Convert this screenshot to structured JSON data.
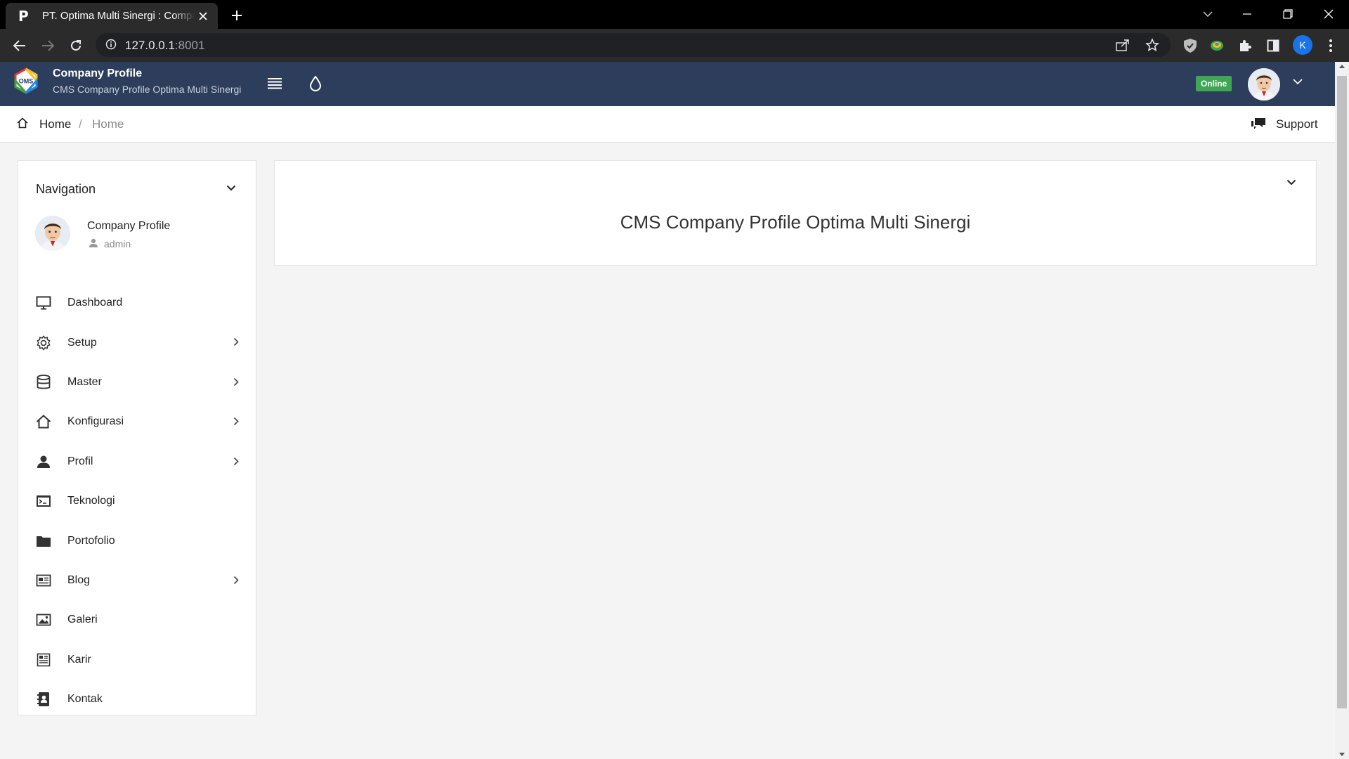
{
  "browser": {
    "tab_title": "PT. Optima Multi Sinergi : Company Profile",
    "favicon_letter": "P",
    "url_host": "127.0.0.1",
    "url_port": ":8001",
    "profile_initial": "K"
  },
  "header": {
    "logo_text": "OMS",
    "brand_title": "Company Profile",
    "brand_subtitle": "CMS Company Profile Optima Multi Sinergi",
    "status_badge": "Online"
  },
  "breadcrumb": {
    "home": "Home",
    "separator": "/",
    "current": "Home",
    "support": "Support"
  },
  "sidebar": {
    "title": "Navigation",
    "user_name": "Company Profile",
    "user_role": "admin",
    "items": [
      {
        "label": "Dashboard",
        "icon": "monitor-icon",
        "has_children": false
      },
      {
        "label": "Setup",
        "icon": "gear-icon",
        "has_children": true
      },
      {
        "label": "Master",
        "icon": "database-icon",
        "has_children": true
      },
      {
        "label": "Konfigurasi",
        "icon": "home-icon",
        "has_children": true
      },
      {
        "label": "Profil",
        "icon": "user-icon",
        "has_children": true
      },
      {
        "label": "Teknologi",
        "icon": "terminal-icon",
        "has_children": false
      },
      {
        "label": "Portofolio",
        "icon": "folder-icon",
        "has_children": false
      },
      {
        "label": "Blog",
        "icon": "newspaper-icon",
        "has_children": true
      },
      {
        "label": "Galeri",
        "icon": "image-icon",
        "has_children": false
      },
      {
        "label": "Karir",
        "icon": "document-icon",
        "has_children": false
      },
      {
        "label": "Kontak",
        "icon": "address-book-icon",
        "has_children": false
      }
    ]
  },
  "main": {
    "panel_title": "CMS Company Profile Optima Multi Sinergi"
  },
  "colors": {
    "header_bg": "#2c3e5c",
    "online_badge": "#3fa655",
    "page_bg": "#f4f4f4"
  }
}
